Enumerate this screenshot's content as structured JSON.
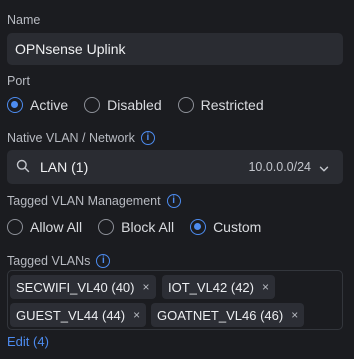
{
  "name": {
    "label": "Name",
    "value": "OPNsense Uplink"
  },
  "port": {
    "label": "Port",
    "options": [
      "Active",
      "Disabled",
      "Restricted"
    ],
    "selected": "Active"
  },
  "native_vlan": {
    "label": "Native VLAN / Network",
    "value": "LAN (1)",
    "subnet": "10.0.0.0/24"
  },
  "tagged_mgmt": {
    "label": "Tagged VLAN Management",
    "options": [
      "Allow All",
      "Block All",
      "Custom"
    ],
    "selected": "Custom"
  },
  "tagged_vlans": {
    "label": "Tagged VLANs",
    "tags": [
      "SECWIFI_VL40 (40)",
      "IOT_VL42 (42)",
      "GUEST_VL44 (44)",
      "GOATNET_VL46 (46)"
    ],
    "remove_glyph": "×"
  },
  "edit_link": "Edit (4)",
  "info_glyph": "i",
  "colors": {
    "background": "#1b1c20",
    "field": "#2a2c32",
    "accent": "#4d8cf0",
    "tag": "#2c2e35"
  }
}
